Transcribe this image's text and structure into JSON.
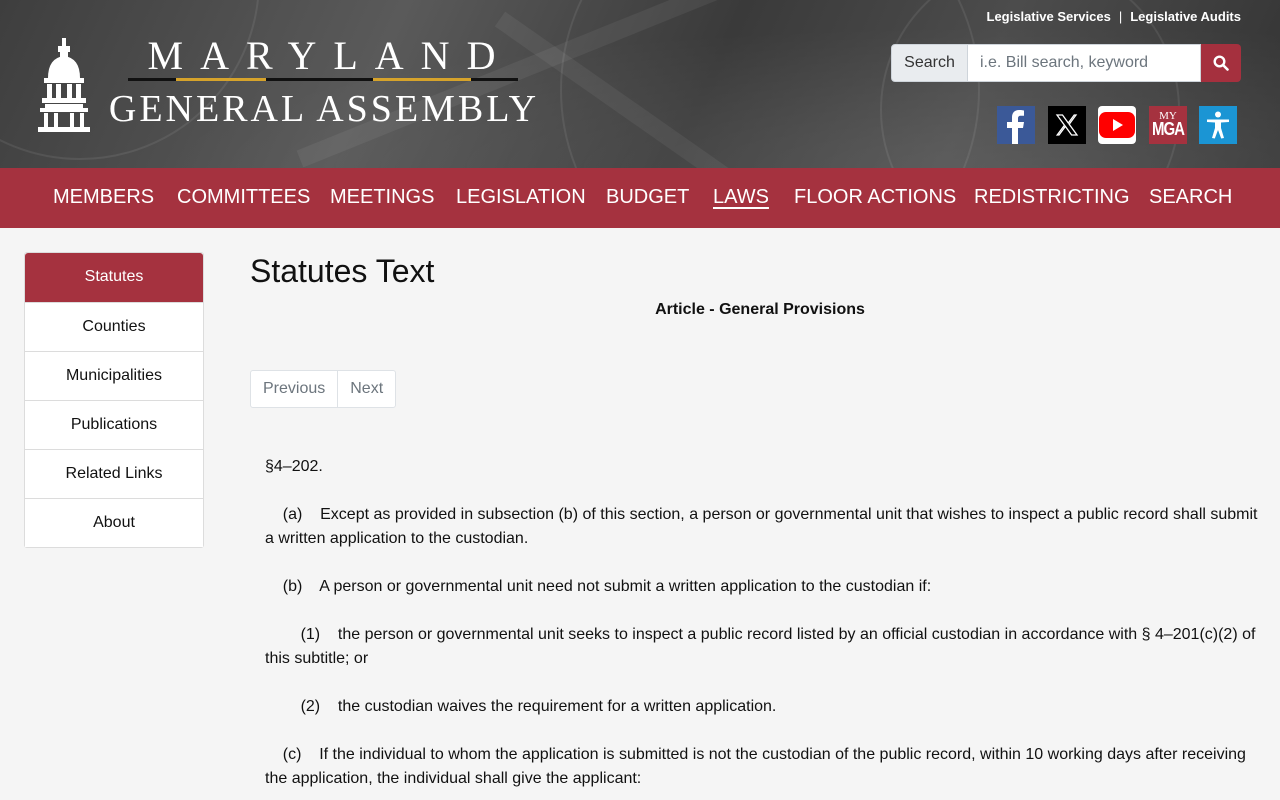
{
  "header": {
    "logo_top": "MARYLAND",
    "logo_bottom": "GENERAL ASSEMBLY",
    "top_links": [
      "Legislative Services",
      "Legislative Audits"
    ],
    "search": {
      "label": "Search",
      "placeholder": "i.e. Bill search, keyword"
    },
    "social": [
      {
        "name": "facebook-icon",
        "color": "#3b5998"
      },
      {
        "name": "x-icon",
        "color": "#000000"
      },
      {
        "name": "youtube-icon",
        "color": "#ff0000"
      },
      {
        "name": "my-mga-icon",
        "color": "#a5323f",
        "text_top": "MY",
        "text_bottom": "MGA"
      },
      {
        "name": "accessibility-icon",
        "color": "#1b95d4"
      }
    ]
  },
  "nav": {
    "items": [
      "MEMBERS",
      "COMMITTEES",
      "MEETINGS",
      "LEGISLATION",
      "BUDGET",
      "LAWS",
      "FLOOR ACTIONS",
      "REDISTRICTING",
      "SEARCH"
    ],
    "active": "LAWS"
  },
  "sidebar": {
    "items": [
      "Statutes",
      "Counties",
      "Municipalities",
      "Publications",
      "Related Links",
      "About"
    ],
    "active": "Statutes"
  },
  "main": {
    "title": "Statutes Text",
    "article": "Article - General Provisions",
    "pager": {
      "previous": "Previous",
      "next": "Next"
    },
    "paragraphs": [
      "§4–202.",
      "    (a)    Except as provided in subsection (b) of this section, a person or governmental unit that wishes to inspect a public record shall submit a written application to the custodian.",
      "    (b)    A person or governmental unit need not submit a written application to the custodian if:",
      "        (1)    the person or governmental unit seeks to inspect a public record listed by an official custodian in accordance with § 4–201(c)(2) of this subtitle; or",
      "        (2)    the custodian waives the requirement for a written application.",
      "    (c)    If the individual to whom the application is submitted is not the custodian of the public record, within 10 working days after receiving the application, the individual shall give the applicant:"
    ]
  },
  "colors": {
    "brand": "#a5323f",
    "gold": "#d6a32b"
  }
}
